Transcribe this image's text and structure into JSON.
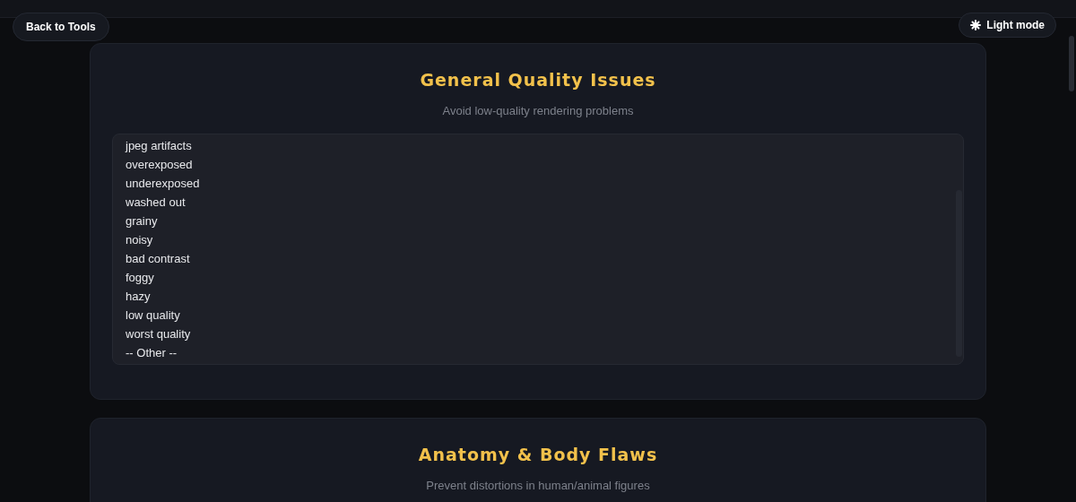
{
  "back_button": {
    "label": "Back to Tools"
  },
  "theme_toggle": {
    "label": "Light mode"
  },
  "sections": [
    {
      "title": "General Quality Issues",
      "subtitle": "Avoid low-quality rendering problems",
      "options": [
        "jpeg artifacts",
        "overexposed",
        "underexposed",
        "washed out",
        "grainy",
        "noisy",
        "bad contrast",
        "foggy",
        "hazy",
        "low quality",
        "worst quality",
        "-- Other --"
      ]
    },
    {
      "title": "Anatomy & Body Flaws",
      "subtitle": "Prevent distortions in human/animal figures"
    }
  ]
}
